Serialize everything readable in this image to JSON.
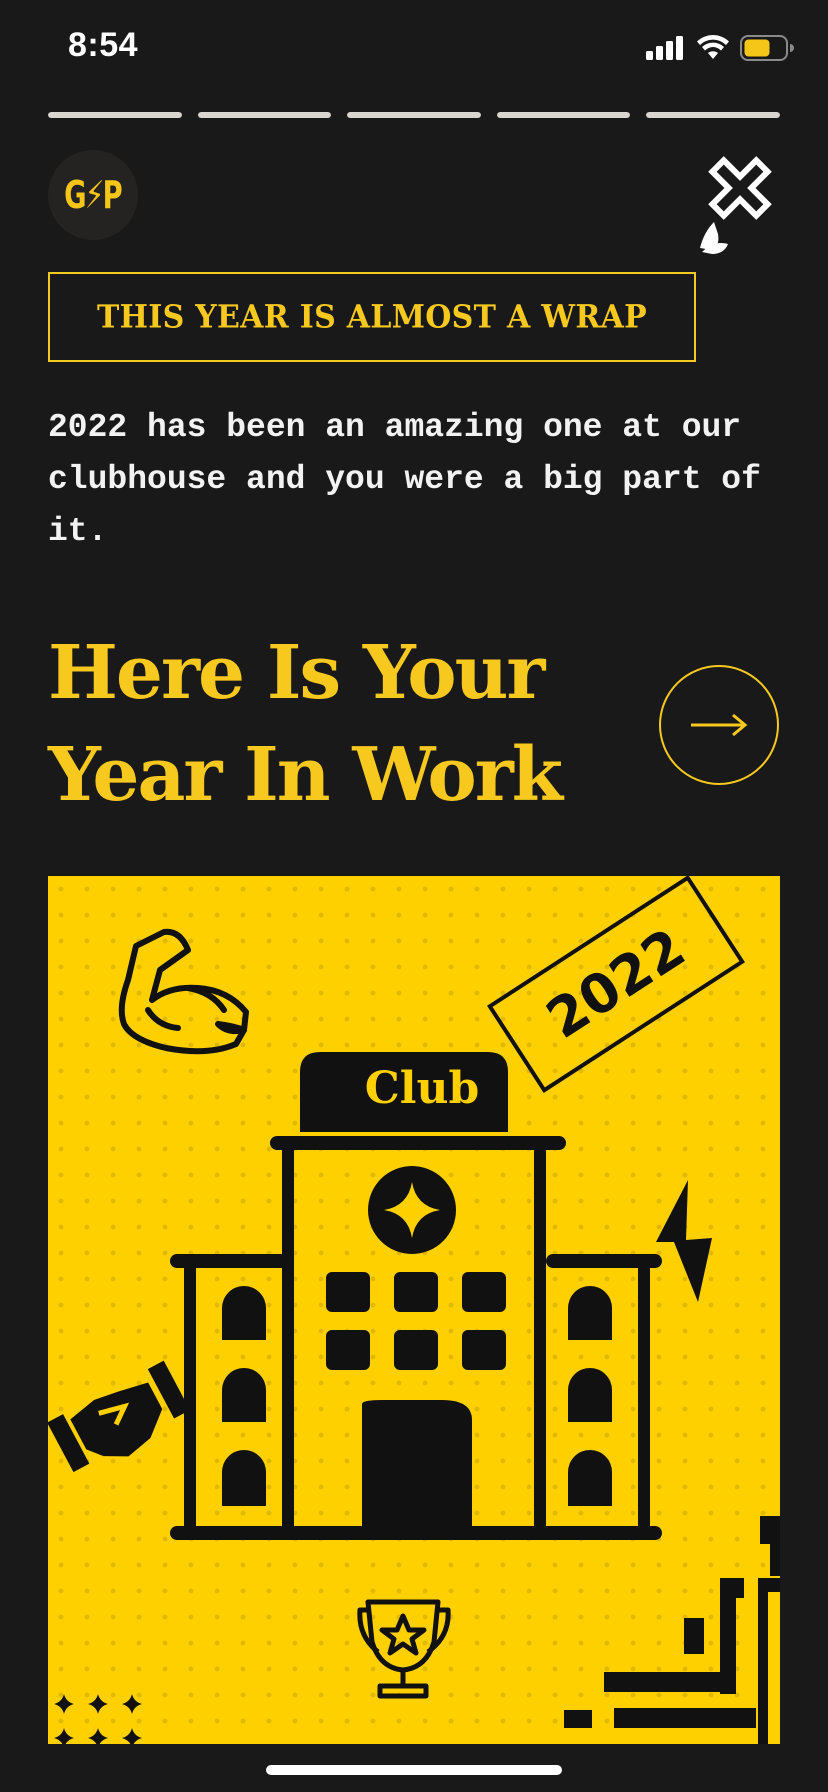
{
  "status": {
    "time": "8:54",
    "icons": [
      "cellular-signal-icon",
      "wifi-icon",
      "battery-icon"
    ],
    "battery_color": "#f5c518"
  },
  "story": {
    "segments": [
      1,
      1,
      1,
      1,
      1
    ],
    "logo_text": "G⚡P",
    "close_icon": "close-x-icon"
  },
  "content": {
    "banner": "THIS YEAR IS ALMOST A WRAP",
    "intro": "2022 has been an amazing one at our clubhouse and you were a big part of it.",
    "headline": "Here Is Your Year In Work",
    "next_icon": "arrow-right-icon"
  },
  "poster": {
    "year_tag": "2022",
    "building_sign": "Club",
    "icons": [
      "flexed-bicep-icon",
      "lightning-bolt-icon",
      "handshake-icon",
      "trophy-icon",
      "sparkles-icon"
    ]
  },
  "colors": {
    "background": "#1a1919",
    "accent": "#f7c81e",
    "poster_bg": "#ffd000",
    "ink": "#111111"
  }
}
